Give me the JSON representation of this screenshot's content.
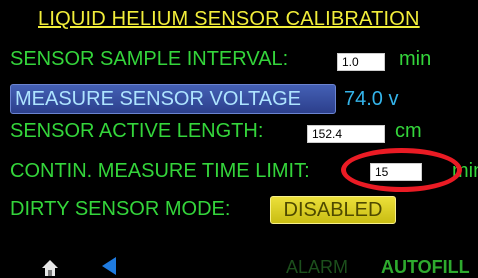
{
  "title": "LIQUID HELIUM SENSOR CALIBRATION",
  "sample_interval": {
    "label": "SENSOR SAMPLE INTERVAL:",
    "value": "1.0",
    "unit": "min"
  },
  "measure": {
    "button_label": "MEASURE SENSOR VOLTAGE",
    "voltage": "74.0 v"
  },
  "active_length": {
    "label": "SENSOR ACTIVE LENGTH:",
    "value": "152.4",
    "unit": "cm"
  },
  "time_limit": {
    "label": "CONTIN. MEASURE TIME LIMIT:",
    "value": "15",
    "unit": "min"
  },
  "dirty_mode": {
    "label": "DIRTY SENSOR MODE:",
    "button_label": "DISABLED"
  },
  "footer": {
    "alarm": "ALARM",
    "autofill": "AUTOFILL"
  },
  "icons": {
    "home": "home-icon",
    "back": "back-arrow-icon"
  },
  "colors": {
    "label_green": "#34d53b",
    "title_yellow": "#f2ee3a",
    "voltage_blue": "#34b4ea",
    "highlight_red": "#ea1b24"
  }
}
